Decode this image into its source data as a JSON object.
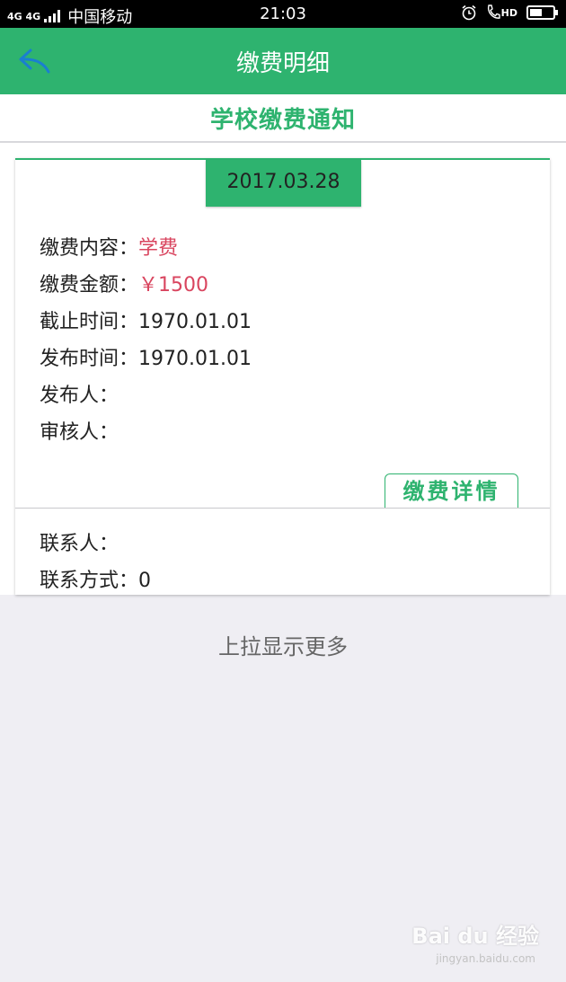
{
  "status_bar": {
    "network": "4G 4G",
    "carrier": "中国移动",
    "time": "21:03",
    "hd": "HD",
    "battery_level": 0.55
  },
  "header": {
    "title": "缴费明细",
    "back_icon": "back-arrow-icon"
  },
  "subheader": {
    "title": "学校缴费通知"
  },
  "card": {
    "date": "2017.03.28",
    "rows": [
      {
        "label": "缴费内容：",
        "value": "学费"
      },
      {
        "label": "缴费金额：",
        "value": "￥1500"
      },
      {
        "label": "截止时间：",
        "value": "1970.01.01"
      },
      {
        "label": "发布时间：",
        "value": "1970.01.01"
      },
      {
        "label": "发布人：",
        "value": ""
      },
      {
        "label": "审核人：",
        "value": ""
      }
    ],
    "detail_button": "缴费详情",
    "contact_rows": [
      {
        "label": "联系人：",
        "value": ""
      },
      {
        "label": "联系方式：",
        "value": "0"
      }
    ]
  },
  "footer": {
    "pull_more": "上拉显示更多"
  },
  "watermark": {
    "brand": "Bai du 经验",
    "url": "jingyan.baidu.com"
  },
  "colors": {
    "accent": "#2eb36f",
    "highlight": "#d9455f",
    "background": "#efeef3"
  }
}
